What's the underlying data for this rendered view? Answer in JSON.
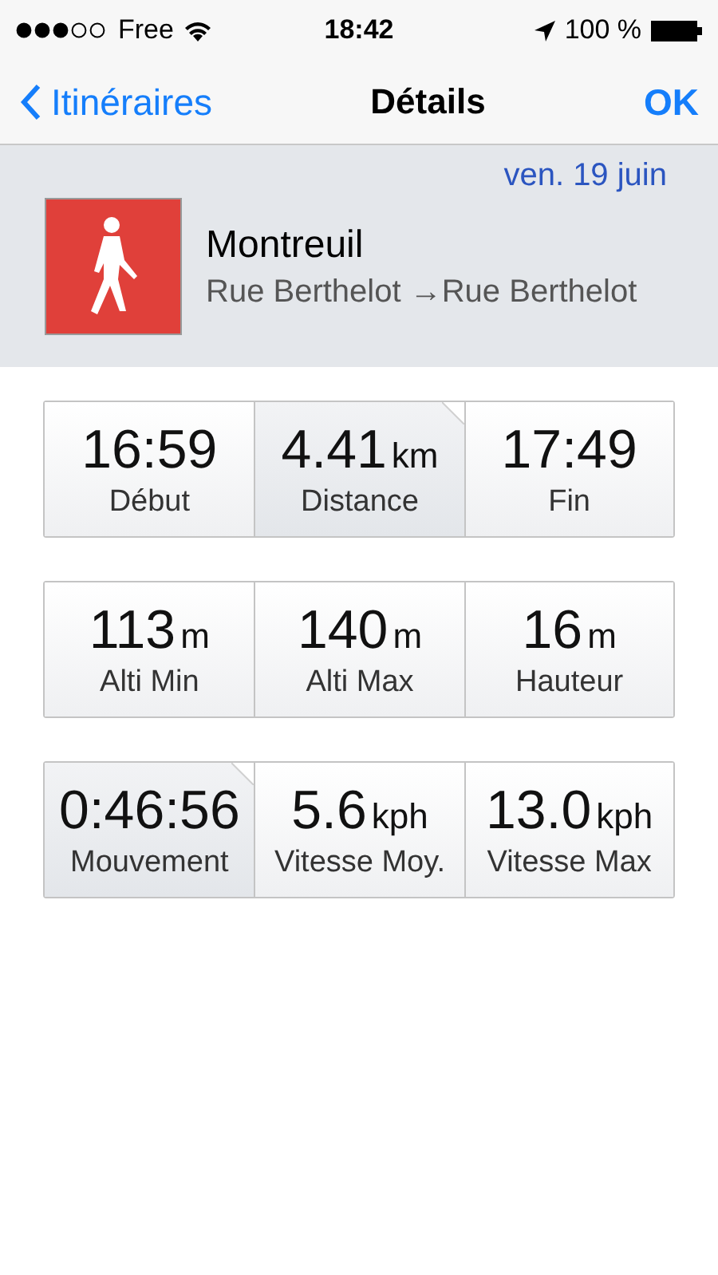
{
  "status_bar": {
    "carrier": "Free",
    "time": "18:42",
    "battery": "100 %"
  },
  "nav": {
    "back": "Itinéraires",
    "title": "Détails",
    "done": "OK"
  },
  "trip": {
    "date": "ven. 19 juin",
    "title": "Montreuil",
    "from": "Rue Berthelot",
    "arrow": "→",
    "to": "Rue Berthelot"
  },
  "stat_rows": [
    [
      {
        "value": "16:59",
        "label": "Début",
        "selected": false
      },
      {
        "value": "4.41",
        "unit": "km",
        "label": "Distance",
        "selected": true
      },
      {
        "value": "17:49",
        "label": "Fin",
        "selected": false
      }
    ],
    [
      {
        "value": "113",
        "unit": "m",
        "label": "Alti Min",
        "selected": false
      },
      {
        "value": "140",
        "unit": "m",
        "label": "Alti Max",
        "selected": false
      },
      {
        "value": "16",
        "unit": "m",
        "label": "Hauteur",
        "selected": false
      }
    ],
    [
      {
        "value": "0:46:56",
        "label": "Mouvement",
        "selected": true
      },
      {
        "value": "5.6",
        "unit": "kph",
        "label": "Vitesse Moy.",
        "selected": false
      },
      {
        "value": "13.0",
        "unit": "kph",
        "label": "Vitesse Max",
        "selected": false
      }
    ]
  ]
}
